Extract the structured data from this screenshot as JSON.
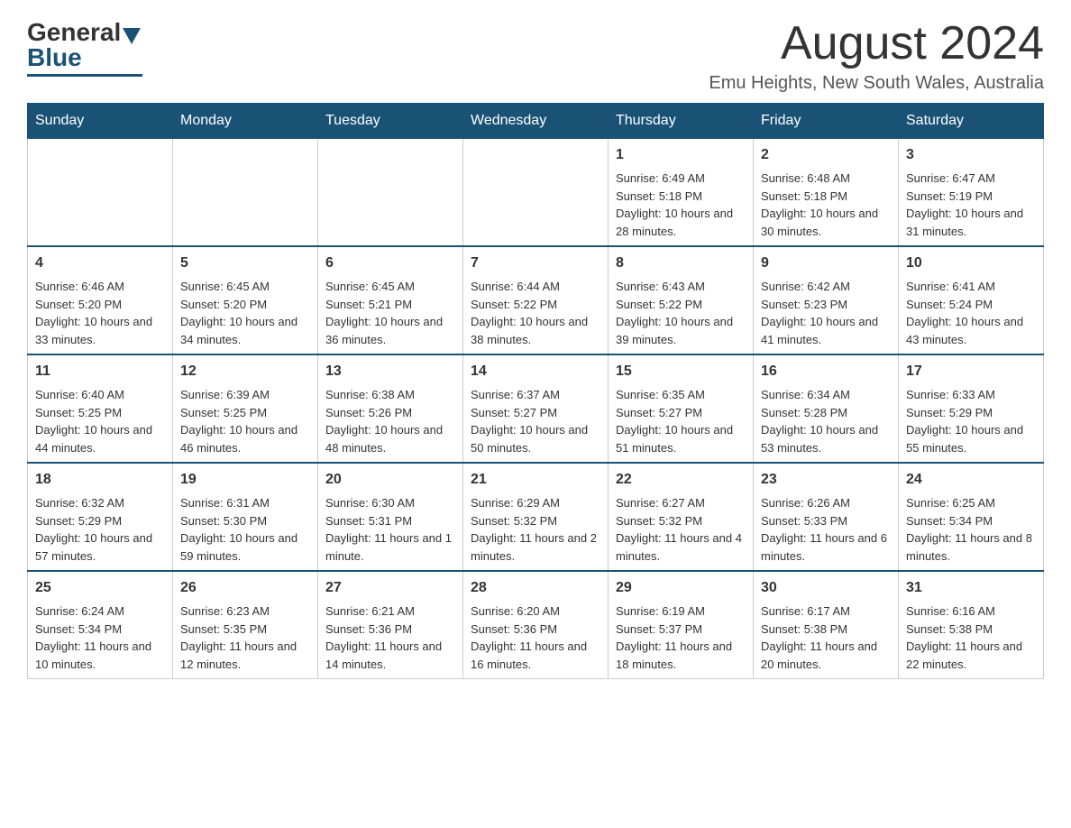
{
  "logo": {
    "general": "General",
    "blue": "Blue"
  },
  "header": {
    "month_title": "August 2024",
    "location": "Emu Heights, New South Wales, Australia"
  },
  "days_of_week": [
    "Sunday",
    "Monday",
    "Tuesday",
    "Wednesday",
    "Thursday",
    "Friday",
    "Saturday"
  ],
  "weeks": [
    [
      {
        "day": "",
        "info": ""
      },
      {
        "day": "",
        "info": ""
      },
      {
        "day": "",
        "info": ""
      },
      {
        "day": "",
        "info": ""
      },
      {
        "day": "1",
        "info": "Sunrise: 6:49 AM\nSunset: 5:18 PM\nDaylight: 10 hours and 28 minutes."
      },
      {
        "day": "2",
        "info": "Sunrise: 6:48 AM\nSunset: 5:18 PM\nDaylight: 10 hours and 30 minutes."
      },
      {
        "day": "3",
        "info": "Sunrise: 6:47 AM\nSunset: 5:19 PM\nDaylight: 10 hours and 31 minutes."
      }
    ],
    [
      {
        "day": "4",
        "info": "Sunrise: 6:46 AM\nSunset: 5:20 PM\nDaylight: 10 hours and 33 minutes."
      },
      {
        "day": "5",
        "info": "Sunrise: 6:45 AM\nSunset: 5:20 PM\nDaylight: 10 hours and 34 minutes."
      },
      {
        "day": "6",
        "info": "Sunrise: 6:45 AM\nSunset: 5:21 PM\nDaylight: 10 hours and 36 minutes."
      },
      {
        "day": "7",
        "info": "Sunrise: 6:44 AM\nSunset: 5:22 PM\nDaylight: 10 hours and 38 minutes."
      },
      {
        "day": "8",
        "info": "Sunrise: 6:43 AM\nSunset: 5:22 PM\nDaylight: 10 hours and 39 minutes."
      },
      {
        "day": "9",
        "info": "Sunrise: 6:42 AM\nSunset: 5:23 PM\nDaylight: 10 hours and 41 minutes."
      },
      {
        "day": "10",
        "info": "Sunrise: 6:41 AM\nSunset: 5:24 PM\nDaylight: 10 hours and 43 minutes."
      }
    ],
    [
      {
        "day": "11",
        "info": "Sunrise: 6:40 AM\nSunset: 5:25 PM\nDaylight: 10 hours and 44 minutes."
      },
      {
        "day": "12",
        "info": "Sunrise: 6:39 AM\nSunset: 5:25 PM\nDaylight: 10 hours and 46 minutes."
      },
      {
        "day": "13",
        "info": "Sunrise: 6:38 AM\nSunset: 5:26 PM\nDaylight: 10 hours and 48 minutes."
      },
      {
        "day": "14",
        "info": "Sunrise: 6:37 AM\nSunset: 5:27 PM\nDaylight: 10 hours and 50 minutes."
      },
      {
        "day": "15",
        "info": "Sunrise: 6:35 AM\nSunset: 5:27 PM\nDaylight: 10 hours and 51 minutes."
      },
      {
        "day": "16",
        "info": "Sunrise: 6:34 AM\nSunset: 5:28 PM\nDaylight: 10 hours and 53 minutes."
      },
      {
        "day": "17",
        "info": "Sunrise: 6:33 AM\nSunset: 5:29 PM\nDaylight: 10 hours and 55 minutes."
      }
    ],
    [
      {
        "day": "18",
        "info": "Sunrise: 6:32 AM\nSunset: 5:29 PM\nDaylight: 10 hours and 57 minutes."
      },
      {
        "day": "19",
        "info": "Sunrise: 6:31 AM\nSunset: 5:30 PM\nDaylight: 10 hours and 59 minutes."
      },
      {
        "day": "20",
        "info": "Sunrise: 6:30 AM\nSunset: 5:31 PM\nDaylight: 11 hours and 1 minute."
      },
      {
        "day": "21",
        "info": "Sunrise: 6:29 AM\nSunset: 5:32 PM\nDaylight: 11 hours and 2 minutes."
      },
      {
        "day": "22",
        "info": "Sunrise: 6:27 AM\nSunset: 5:32 PM\nDaylight: 11 hours and 4 minutes."
      },
      {
        "day": "23",
        "info": "Sunrise: 6:26 AM\nSunset: 5:33 PM\nDaylight: 11 hours and 6 minutes."
      },
      {
        "day": "24",
        "info": "Sunrise: 6:25 AM\nSunset: 5:34 PM\nDaylight: 11 hours and 8 minutes."
      }
    ],
    [
      {
        "day": "25",
        "info": "Sunrise: 6:24 AM\nSunset: 5:34 PM\nDaylight: 11 hours and 10 minutes."
      },
      {
        "day": "26",
        "info": "Sunrise: 6:23 AM\nSunset: 5:35 PM\nDaylight: 11 hours and 12 minutes."
      },
      {
        "day": "27",
        "info": "Sunrise: 6:21 AM\nSunset: 5:36 PM\nDaylight: 11 hours and 14 minutes."
      },
      {
        "day": "28",
        "info": "Sunrise: 6:20 AM\nSunset: 5:36 PM\nDaylight: 11 hours and 16 minutes."
      },
      {
        "day": "29",
        "info": "Sunrise: 6:19 AM\nSunset: 5:37 PM\nDaylight: 11 hours and 18 minutes."
      },
      {
        "day": "30",
        "info": "Sunrise: 6:17 AM\nSunset: 5:38 PM\nDaylight: 11 hours and 20 minutes."
      },
      {
        "day": "31",
        "info": "Sunrise: 6:16 AM\nSunset: 5:38 PM\nDaylight: 11 hours and 22 minutes."
      }
    ]
  ]
}
